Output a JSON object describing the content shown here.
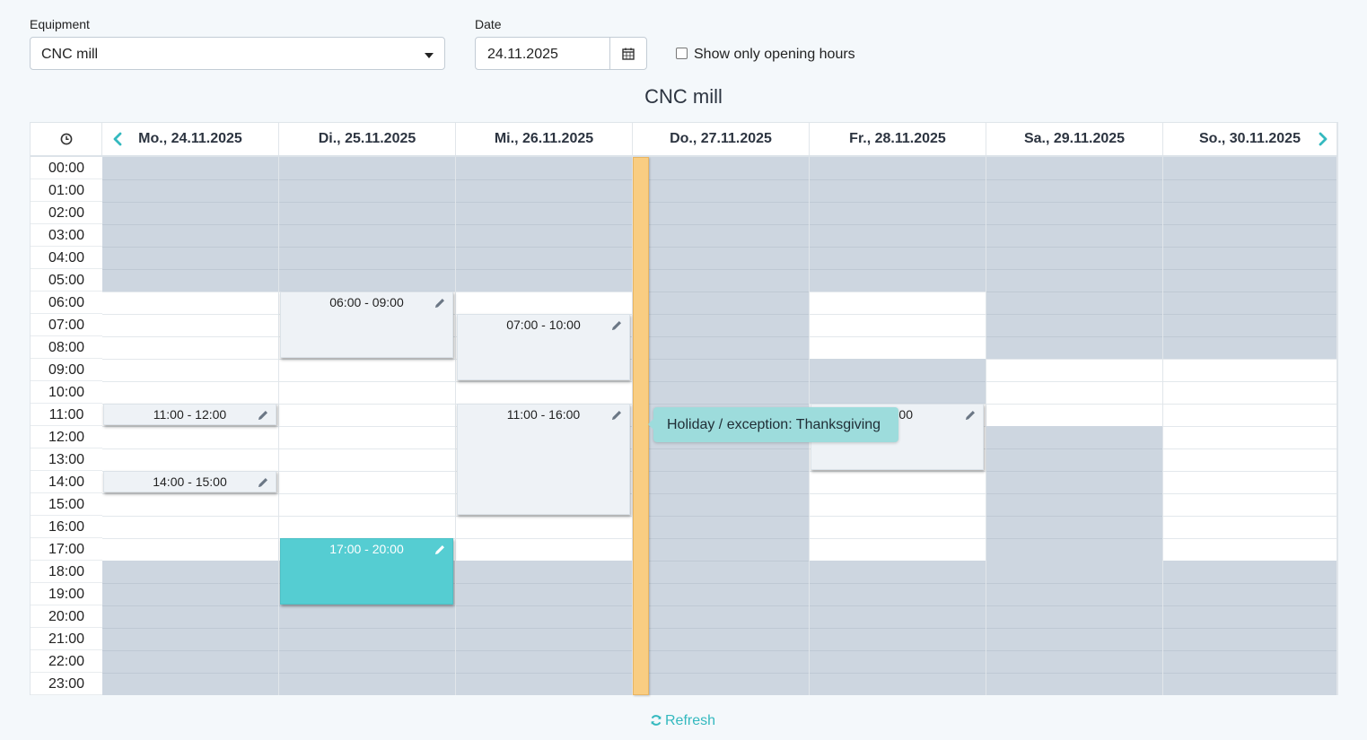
{
  "filters": {
    "equipment_label": "Equipment",
    "equipment_value": "CNC mill",
    "date_label": "Date",
    "date_value": "24.11.2025",
    "opening_hours_label": "Show only opening hours",
    "opening_hours_checked": false
  },
  "calendar": {
    "title": "CNC mill",
    "days": [
      "Mo., 24.11.2025",
      "Di., 25.11.2025",
      "Mi., 26.11.2025",
      "Do., 27.11.2025",
      "Fr., 28.11.2025",
      "Sa., 29.11.2025",
      "So., 30.11.2025"
    ],
    "hours": [
      "00:00",
      "01:00",
      "02:00",
      "03:00",
      "04:00",
      "05:00",
      "06:00",
      "07:00",
      "08:00",
      "09:00",
      "10:00",
      "11:00",
      "12:00",
      "13:00",
      "14:00",
      "15:00",
      "16:00",
      "17:00",
      "18:00",
      "19:00",
      "20:00",
      "21:00",
      "22:00",
      "23:00"
    ],
    "closed": [
      {
        "day": 0,
        "ranges": [
          [
            0,
            6
          ],
          [
            18,
            24
          ]
        ]
      },
      {
        "day": 1,
        "ranges": [
          [
            0,
            6
          ],
          [
            18,
            24
          ]
        ]
      },
      {
        "day": 2,
        "ranges": [
          [
            0,
            6
          ],
          [
            18,
            24
          ]
        ]
      },
      {
        "day": 3,
        "ranges": [
          [
            0,
            24
          ]
        ]
      },
      {
        "day": 4,
        "ranges": [
          [
            0,
            6
          ],
          [
            9,
            11
          ],
          [
            18,
            24
          ]
        ]
      },
      {
        "day": 5,
        "ranges": [
          [
            0,
            9
          ],
          [
            12,
            18
          ],
          [
            18,
            24
          ]
        ]
      },
      {
        "day": 6,
        "ranges": [
          [
            0,
            9
          ],
          [
            18,
            24
          ]
        ]
      }
    ],
    "events": [
      {
        "day": 0,
        "start": 11,
        "end": 12,
        "label": "11:00 - 12:00",
        "style": "slot"
      },
      {
        "day": 0,
        "start": 14,
        "end": 15,
        "label": "14:00 - 15:00",
        "style": "slot"
      },
      {
        "day": 1,
        "start": 6,
        "end": 9,
        "label": "06:00 - 09:00",
        "style": "slot"
      },
      {
        "day": 1,
        "start": 17,
        "end": 20,
        "label": "17:00 - 20:00",
        "style": "booked"
      },
      {
        "day": 2,
        "start": 7,
        "end": 10,
        "label": "07:00 - 10:00",
        "style": "slot"
      },
      {
        "day": 2,
        "start": 11,
        "end": 16,
        "label": "11:00 - 16:00",
        "style": "slot"
      },
      {
        "day": 4,
        "start": 11,
        "end": 14,
        "label": "14:00",
        "style": "slot"
      }
    ],
    "holiday_tooltip": "Holiday / exception: Thanksgiving"
  },
  "refresh_label": "Refresh",
  "colors": {
    "accent": "#34b9bf",
    "booked": "#55cdd2",
    "closed": "#cdd6e0",
    "holiday": "#f9cd82",
    "tooltip": "#9ddcdc"
  }
}
